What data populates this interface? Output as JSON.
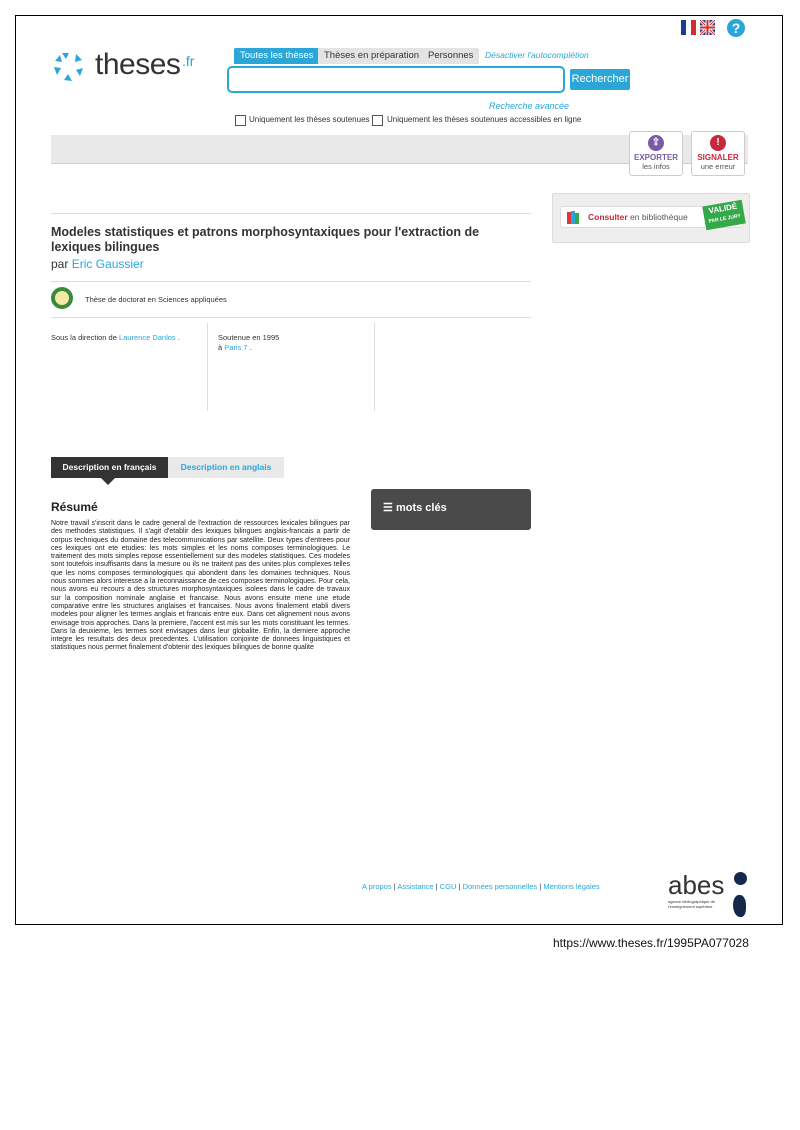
{
  "header": {
    "logo_text": "theses",
    "logo_suffix": ".fr",
    "help": "?",
    "tabs": [
      "Toutes les thèses",
      "Thèses en préparation",
      "Personnes"
    ],
    "disable_autocomplete": "Désactiver l'autocomplétion",
    "search_button": "Rechercher",
    "advanced_search": "Recherche avancée",
    "filter1": "Uniquement les thèses soutenues",
    "filter2": "Uniquement les thèses soutenues accessibles en ligne"
  },
  "actions": {
    "export_title": "EXPORTER",
    "export_sub": "les infos",
    "report_title": "SIGNALER",
    "report_sub": "une erreur"
  },
  "consult": {
    "label_bold": "Consulter",
    "label_rest": " en bibliothèque",
    "valid_1": "VALIDÉ",
    "valid_2": "PAR LE JURY"
  },
  "thesis": {
    "title": "Modeles statistiques et patrons morphosyntaxiques pour l'extraction de lexiques bilingues",
    "by": "par",
    "author": "Eric Gaussier",
    "degree": "Thèse de doctorat en Sciences appliquées",
    "direction_label": "Sous la direction de",
    "director": "Laurence Danlos",
    "defended": "Soutenue en 1995",
    "at": "à",
    "university": "Paris 7"
  },
  "description": {
    "tab_fr": "Description en français",
    "tab_en": "Description en anglais",
    "resume_title": "Résumé",
    "resume": "Notre travail s'inscrit dans le cadre general de l'extraction de ressources lexicales bilingues par des methodes statistiques. Il s'agit d'etablir des lexiques bilingues anglais-francais a partir de corpus techniques du domaine des telecommunications par satellite. Deux types d'entrees pour ces lexiques ont ete etudies: les mots simples et les noms composes terminologiques. Le traitement des mots simples repose essentiellement sur des modeles statistiques. Ces modeles sont toutefois insuffisants dans la mesure ou ils ne traitent pas des unites plus complexes telles que les noms composes terminologiques qui abondent dans les domaines techniques. Nous nous sommes alors interesse a la reconnaissance de ces composes terminologiques. Pour cela, nous avons eu recours a des structures morphosyntaxiques isolees dans le cadre de travaux sur la composition nominale anglaise et francaise. Nous avons ensuite mene une etude comparative entre les structures anglaises et francaises. Nous avons finalement etabli divers modeles pour aligner les termes anglais et francais entre eux. Dans cet alignement nous avons envisage trois approches. Dans la premiere, l'accent est mis sur les mots constituant les termes. Dans la deuxieme, les termes sont envisages dans leur globalite. Enfin, la derniere approche integre les resultats des deux precedentes. L'utilisation conjointe de donnees linguistiques et statistiques nous permet finalement d'obtenir des lexiques bilingues de bonne qualite",
    "keywords_title": "mots clés"
  },
  "footer": {
    "links": [
      "A propos",
      "Assistance",
      "CGU",
      "Données personnelles",
      "Mentions légales"
    ],
    "abes": "abes",
    "abes_sub": "agence bibliographique de l'enseignement supérieur"
  },
  "url": "https://www.theses.fr/1995PA077028",
  "colors": {
    "accent": "#2aa6d8",
    "dark": "#333333"
  }
}
